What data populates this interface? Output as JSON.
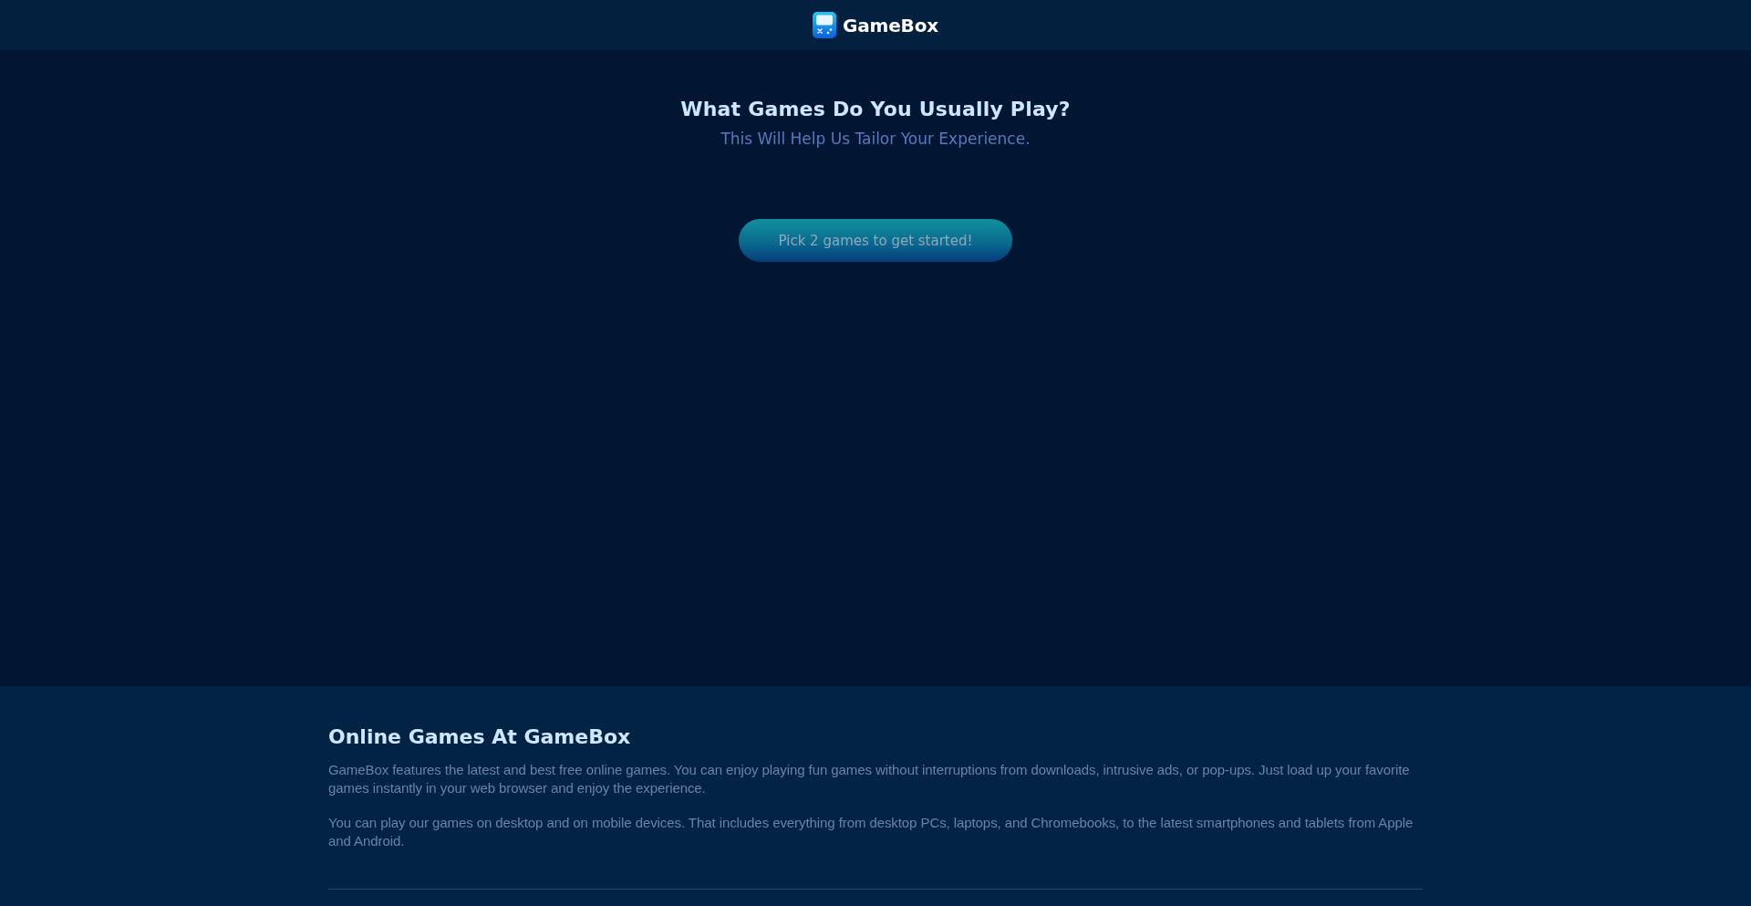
{
  "header": {
    "logo_text": "GameBox"
  },
  "intro": {
    "title": "What Games Do You Usually Play?",
    "subtitle": "This Will Help Us Tailor Your Experience."
  },
  "start_button": {
    "label": "Pick 2 games to get started!",
    "disabled": true
  },
  "about": {
    "heading": "Online Games At GameBox",
    "paragraphs": [
      "GameBox features the latest and best free online games. You can enjoy playing fun games without interruptions from downloads, intrusive ads, or pop-ups. Just load up your favorite games instantly in your web browser and enjoy the experience.",
      "You can play our games on desktop and on mobile devices. That includes everything from desktop PCs, laptops, and Chromebooks, to the latest smartphones and tablets from Apple and Android."
    ]
  }
}
